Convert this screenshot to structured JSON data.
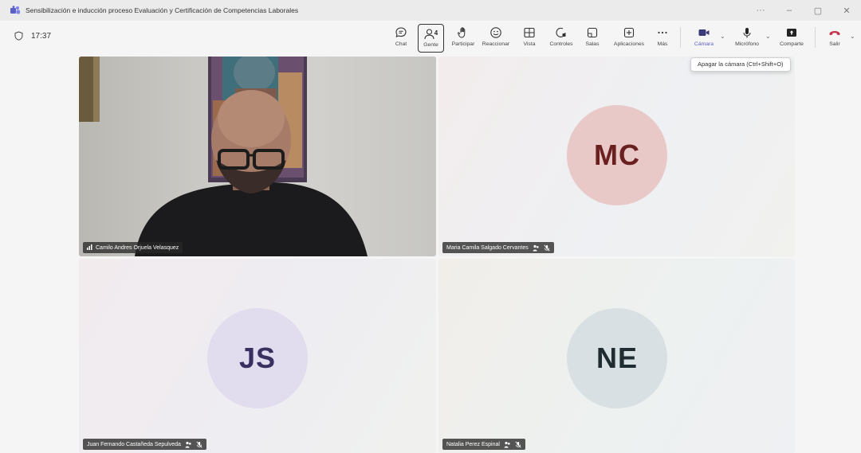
{
  "window": {
    "title": "Sensibilización e inducción proceso Evaluación y Certificación de Competencias Laborales",
    "controls": {
      "more": "···",
      "minimize": "–",
      "restore": "▢",
      "close": "✕"
    }
  },
  "meeting": {
    "elapsed": "17:37"
  },
  "toolbar": {
    "chat": "Chat",
    "people": "Gente",
    "people_count": "4",
    "raise_hand": "Participar",
    "react": "Reaccionar",
    "view": "Vista",
    "controls": "Controles",
    "rooms": "Salas",
    "apps": "Aplicaciones",
    "more": "Más",
    "camera": "Cámara",
    "mic": "Micrófono",
    "share": "Comparte",
    "leave": "Salir"
  },
  "tooltip": {
    "camera_off": "Apagar la cámara (Ctrl+Shift+O)"
  },
  "participants": [
    {
      "name": "Camilo Andres Orjuela Velasquez",
      "initials": "",
      "video": true
    },
    {
      "name": "Maria Camila Salgado Cervantes",
      "initials": "MC",
      "video": false,
      "avatar_bg": "#e9c8c8",
      "avatar_fg": "#6b2020"
    },
    {
      "name": "Juan Fernando Castañeda Sepulveda",
      "initials": "JS",
      "video": false,
      "avatar_bg": "#e2dcef",
      "avatar_fg": "#3a3060"
    },
    {
      "name": "Natalia Perez Espinal",
      "initials": "NE",
      "video": false,
      "avatar_bg": "#d9e0e3",
      "avatar_fg": "#1f2d33"
    }
  ],
  "colors": {
    "leave": "#c4314b",
    "accent": "#5b5fc7"
  }
}
